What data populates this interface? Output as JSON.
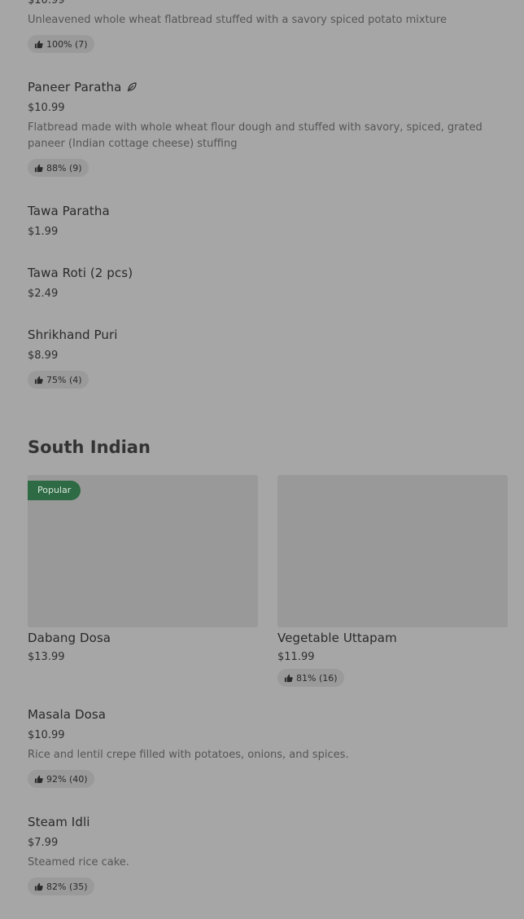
{
  "items_top": [
    {
      "price": "$10.99",
      "desc": "Unleavened whole wheat flatbread stuffed with a savory spiced potato mixture",
      "rating": "100% (7)"
    },
    {
      "name": "Paneer Paratha",
      "price": "$10.99",
      "desc_line1": "Flatbread made with whole wheat flour dough and stuffed with savory, spiced, grated",
      "desc_line2": "paneer (Indian cottage cheese) stuffing",
      "rating": "88% (9)",
      "leaf_icon": "leaf-icon"
    },
    {
      "name": "Tawa Paratha",
      "price": "$1.99"
    },
    {
      "name": "Tawa Roti (2 pcs)",
      "price": "$2.49"
    },
    {
      "name": "Shrikhand Puri",
      "price": "$8.99",
      "rating": "75% (4)"
    }
  ],
  "section": {
    "title": "South Indian"
  },
  "cards": [
    {
      "badge": "Popular",
      "name": "Dabang Dosa",
      "price": "$13.99"
    },
    {
      "name": "Vegetable Uttapam",
      "price": "$11.99",
      "rating": "81% (16)"
    }
  ],
  "items_bottom": [
    {
      "name": "Masala Dosa",
      "price": "$10.99",
      "desc": "Rice and lentil crepe filled with potatoes, onions, and spices.",
      "rating": "92% (40)"
    },
    {
      "name": "Steam Idli",
      "price": "$7.99",
      "desc": "Steamed rice cake.",
      "rating": "82% (35)"
    }
  ],
  "colors": {
    "overlay_bg": "#a6a6a6",
    "badge_bg": "#2e6a43",
    "rating_bg": "#9a9a9a"
  }
}
